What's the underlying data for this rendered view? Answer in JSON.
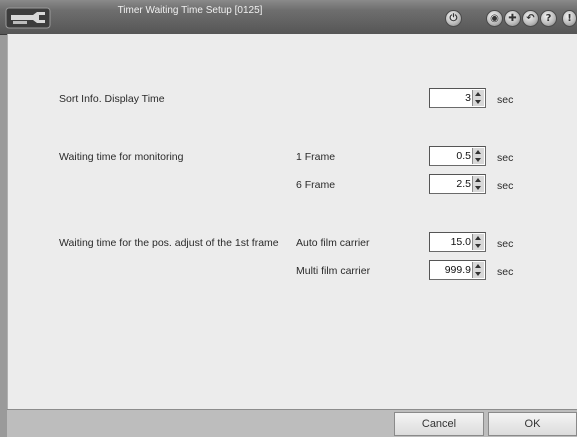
{
  "window": {
    "title": "Timer Waiting Time Setup [0125]",
    "toolbar_icons": [
      "tool-icon",
      "power-icon",
      "globe-icon",
      "compass-icon",
      "back-icon",
      "help-icon",
      "alert-icon"
    ],
    "help_glyph": "?",
    "alert_glyph": "!"
  },
  "settings": {
    "sort_info": {
      "label": "Sort Info. Display Time",
      "value": "3",
      "unit": "sec"
    },
    "monitoring": {
      "label": "Waiting time for monitoring",
      "rows": [
        {
          "sublabel": "1 Frame",
          "value": "0.5",
          "unit": "sec"
        },
        {
          "sublabel": "6 Frame",
          "value": "2.5",
          "unit": "sec"
        }
      ]
    },
    "pos_adjust": {
      "label": "Waiting time for the pos. adjust of the 1st frame",
      "rows": [
        {
          "sublabel": "Auto film carrier",
          "value": "15.0",
          "unit": "sec"
        },
        {
          "sublabel": "Multi film carrier",
          "value": "999.9",
          "unit": "sec"
        }
      ]
    }
  },
  "footer": {
    "cancel_label": "Cancel",
    "ok_label": "OK"
  },
  "colors": {
    "titlebar": "#6e6e6e",
    "content": "#ececec",
    "footer": "#bdbdbd"
  }
}
